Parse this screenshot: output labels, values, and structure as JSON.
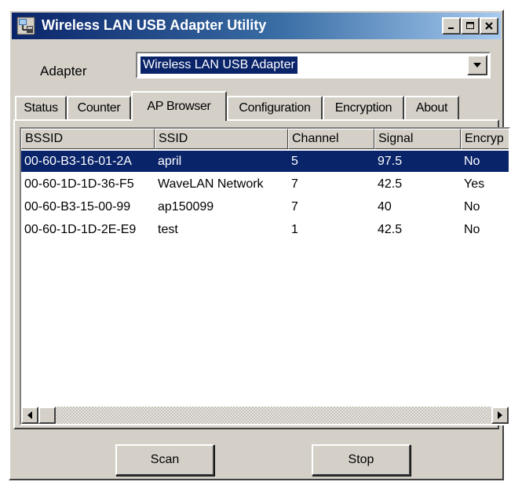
{
  "window": {
    "title": "Wireless LAN USB Adapter Utility",
    "title_gradient_start": "#0a246a",
    "title_gradient_end": "#a6caf0",
    "face_color": "#d4d0c8",
    "icons": [
      "app-icon",
      "minimize-icon",
      "maximize-icon",
      "close-icon"
    ]
  },
  "adapter": {
    "label": "Adapter",
    "selected": "Wireless LAN USB Adapter",
    "dropdown_icon": "chevron-down-icon"
  },
  "tabs": [
    {
      "label": "Status"
    },
    {
      "label": "Counter"
    },
    {
      "label": "AP Browser",
      "active": true
    },
    {
      "label": "Configuration"
    },
    {
      "label": "Encryption"
    },
    {
      "label": "About"
    }
  ],
  "table": {
    "columns": [
      "BSSID",
      "SSID",
      "Channel",
      "Signal",
      "Encryp"
    ],
    "rows": [
      {
        "bssid": "00-60-B3-16-01-2A",
        "ssid": "april",
        "channel": "5",
        "signal": "97.5",
        "encryption": "No",
        "selected": true
      },
      {
        "bssid": "00-60-1D-1D-36-F5",
        "ssid": "WaveLAN Network",
        "channel": "7",
        "signal": "42.5",
        "encryption": "Yes"
      },
      {
        "bssid": "00-60-B3-15-00-99",
        "ssid": "ap150099",
        "channel": "7",
        "signal": "40",
        "encryption": "No"
      },
      {
        "bssid": "00-60-1D-1D-2E-E9",
        "ssid": "test",
        "channel": "1",
        "signal": "42.5",
        "encryption": "No"
      }
    ],
    "selection_color": "#0a246a",
    "scroll_icons": [
      "scroll-left-icon",
      "scroll-right-icon"
    ]
  },
  "buttons": {
    "scan": "Scan",
    "stop": "Stop"
  }
}
